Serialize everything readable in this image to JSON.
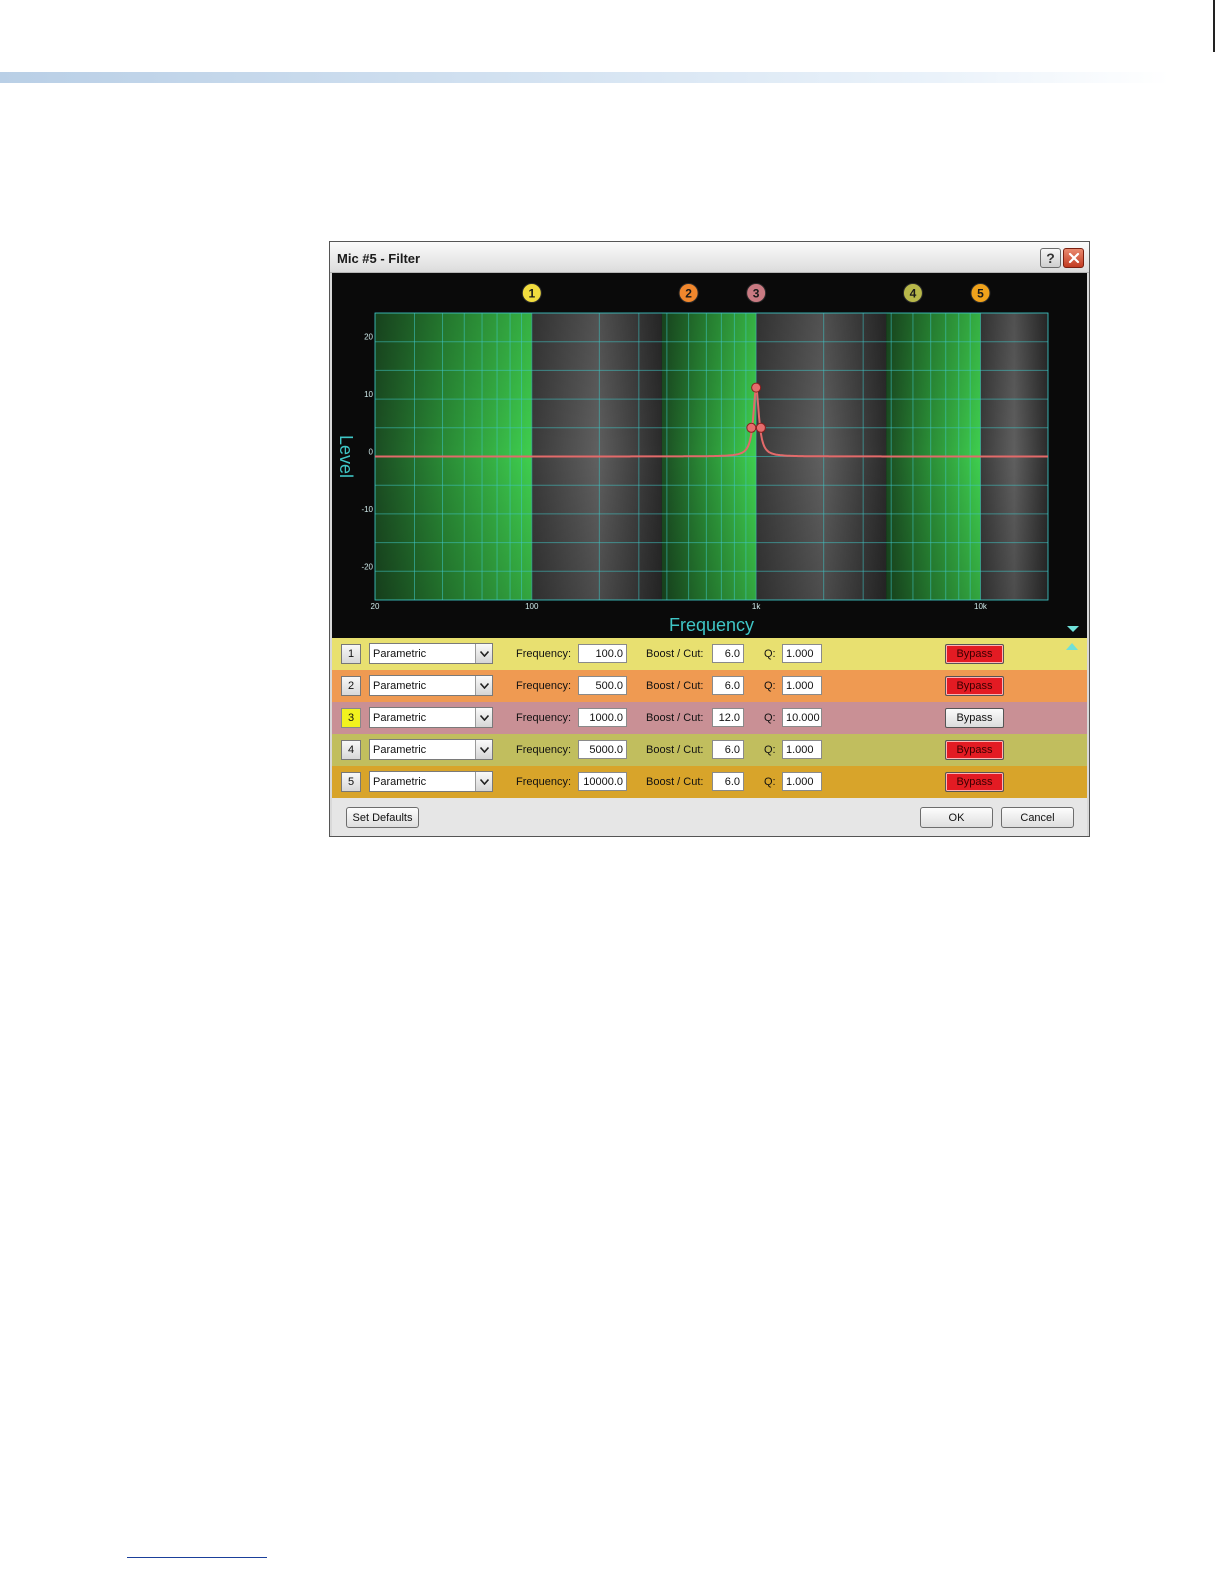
{
  "dialog": {
    "title": "Mic #5 - Filter",
    "help_label": "?",
    "colors": {
      "plot_green": "#22b33c",
      "curve": "#e36a6a",
      "grid": "#3fc6c6",
      "axis_text": "#3fc6c6"
    }
  },
  "band_markers": [
    {
      "label": "1",
      "freq": 100,
      "color": "#f1dc3e"
    },
    {
      "label": "2",
      "freq": 500,
      "color": "#f1872d"
    },
    {
      "label": "3",
      "freq": 1000,
      "color": "#c97a82"
    },
    {
      "label": "4",
      "freq": 5000,
      "color": "#b8b84a"
    },
    {
      "label": "5",
      "freq": 10000,
      "color": "#f0a21b"
    }
  ],
  "chart_data": {
    "type": "line",
    "xlabel": "Frequency",
    "ylabel": "Level",
    "x_scale": "log",
    "xlim": [
      20,
      20000
    ],
    "ylim": [
      -25,
      25
    ],
    "x_ticks": [
      {
        "value": 20,
        "label": "20"
      },
      {
        "value": 100,
        "label": "100"
      },
      {
        "value": 1000,
        "label": "1k"
      },
      {
        "value": 10000,
        "label": "10k"
      }
    ],
    "y_ticks": [
      {
        "value": 20,
        "label": "20"
      },
      {
        "value": 10,
        "label": "10"
      },
      {
        "value": 0,
        "label": "0"
      },
      {
        "value": -10,
        "label": "-10"
      },
      {
        "value": -20,
        "label": "-20"
      }
    ],
    "bands": [
      {
        "freq": 100,
        "gain": 6.0,
        "q": 1.0,
        "bypass": true
      },
      {
        "freq": 500,
        "gain": 6.0,
        "q": 1.0,
        "bypass": true
      },
      {
        "freq": 1000,
        "gain": 12.0,
        "q": 10.0,
        "bypass": false
      },
      {
        "freq": 5000,
        "gain": 6.0,
        "q": 1.0,
        "bypass": true
      },
      {
        "freq": 10000,
        "gain": 6.0,
        "q": 1.0,
        "bypass": true
      }
    ],
    "handles": [
      {
        "freq": 1000,
        "level": 12
      },
      {
        "freq": 952,
        "level": 5
      },
      {
        "freq": 1050,
        "level": 5
      }
    ],
    "grid": true
  },
  "filters": [
    {
      "index": "1",
      "type": "Parametric",
      "freq_label": "Frequency:",
      "frequency": "100.0",
      "boost_label": "Boost / Cut:",
      "boost": "6.0",
      "q_label": "Q:",
      "q": "1.000",
      "bypass_label": "Bypass",
      "bypass_on": true,
      "row_color": "#e8e070",
      "active": false
    },
    {
      "index": "2",
      "type": "Parametric",
      "freq_label": "Frequency:",
      "frequency": "500.0",
      "boost_label": "Boost / Cut:",
      "boost": "6.0",
      "q_label": "Q:",
      "q": "1.000",
      "bypass_label": "Bypass",
      "bypass_on": true,
      "row_color": "#ef9a52",
      "active": false
    },
    {
      "index": "3",
      "type": "Parametric",
      "freq_label": "Frequency:",
      "frequency": "1000.0",
      "boost_label": "Boost / Cut:",
      "boost": "12.0",
      "q_label": "Q:",
      "q": "10.000",
      "bypass_label": "Bypass",
      "bypass_on": false,
      "row_color": "#c99095",
      "active": true
    },
    {
      "index": "4",
      "type": "Parametric",
      "freq_label": "Frequency:",
      "frequency": "5000.0",
      "boost_label": "Boost / Cut:",
      "boost": "6.0",
      "q_label": "Q:",
      "q": "1.000",
      "bypass_label": "Bypass",
      "bypass_on": true,
      "row_color": "#c1be5e",
      "active": false
    },
    {
      "index": "5",
      "type": "Parametric",
      "freq_label": "Frequency:",
      "frequency": "10000.0",
      "boost_label": "Boost / Cut:",
      "boost": "6.0",
      "q_label": "Q:",
      "q": "1.000",
      "bypass_label": "Bypass",
      "bypass_on": true,
      "row_color": "#d8a42a",
      "active": false
    }
  ],
  "footer": {
    "set_defaults": "Set Defaults",
    "ok": "OK",
    "cancel": "Cancel"
  }
}
